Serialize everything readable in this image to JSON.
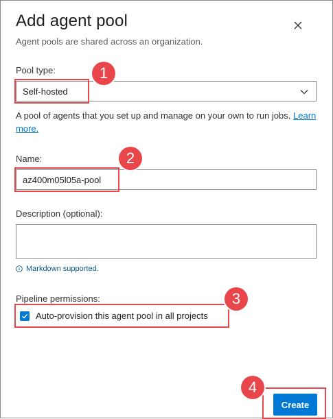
{
  "dialog": {
    "title": "Add agent pool",
    "subtitle": "Agent pools are shared across an organization."
  },
  "pool_type": {
    "label": "Pool type:",
    "selected": "Self-hosted",
    "description": "A pool of agents that you set up and manage on your own to run jobs.",
    "learn_more": "Learn more."
  },
  "name": {
    "label": "Name:",
    "value": "az400m05l05a-pool"
  },
  "description": {
    "label": "Description (optional):",
    "value": "",
    "hint": "Markdown supported."
  },
  "pipeline": {
    "label": "Pipeline permissions:",
    "checkbox_label": "Auto-provision this agent pool in all projects",
    "checked": true
  },
  "buttons": {
    "create": "Create"
  },
  "callouts": [
    "1",
    "2",
    "3",
    "4"
  ],
  "colors": {
    "accent": "#0078d4",
    "callout": "#e8464a"
  }
}
